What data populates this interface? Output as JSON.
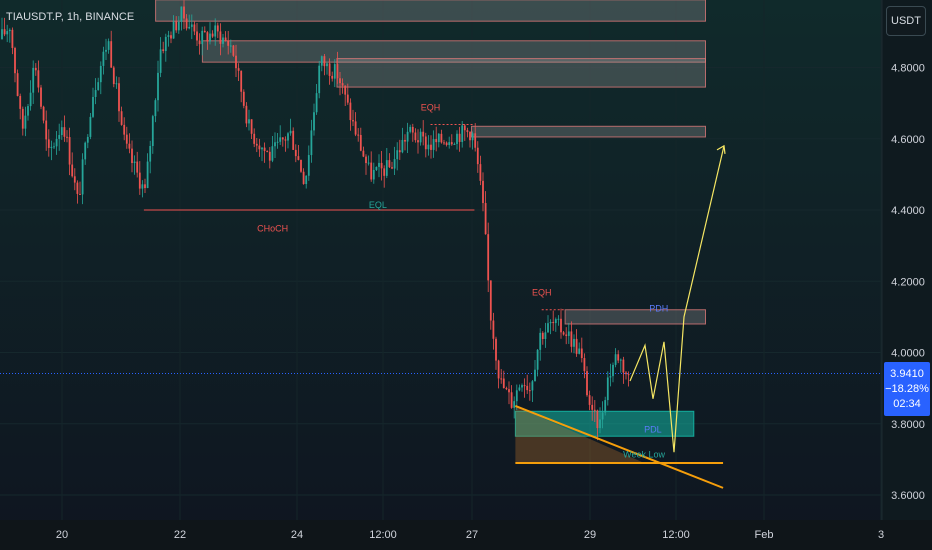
{
  "header": {
    "symbol": "TIAUSDT.P, 1h, BINANCE",
    "currency": "USDT"
  },
  "current": {
    "price": "3.9410",
    "change": "−18.28%",
    "countdown": "02:34"
  },
  "colors": {
    "bull": "#26a69a",
    "bear": "#ef5350",
    "projection": "#f5e663",
    "trendline": "#f59e0b",
    "demand": "#14b8a6",
    "supply": "#9e9e9e",
    "current_line": "#2962ff"
  },
  "chart_data": {
    "type": "candlestick",
    "title": "TIAUSDT.P, 1h, BINANCE",
    "ylim": [
      3.55,
      5.0
    ],
    "y_ticks": [
      "4.8000",
      "4.6000",
      "4.4000",
      "4.2000",
      "4.0000",
      "3.8000",
      "3.6000"
    ],
    "x_ticks": [
      "20",
      "22",
      "24",
      "12:00",
      "27",
      "29",
      "12:00",
      "Feb",
      "3"
    ],
    "current_price": 3.941,
    "zones": [
      {
        "kind": "supply",
        "y": [
          4.93,
          4.99
        ],
        "x": [
          "21.6",
          "31.0"
        ]
      },
      {
        "kind": "supply",
        "y": [
          4.815,
          4.875
        ],
        "x": [
          "22.4",
          "31.0"
        ]
      },
      {
        "kind": "supply",
        "y": [
          4.745,
          4.825
        ],
        "x": [
          "24.7",
          "31.0"
        ]
      },
      {
        "kind": "supply",
        "y": [
          4.605,
          4.635
        ],
        "x": [
          "27.0",
          "31.0"
        ]
      },
      {
        "kind": "supply",
        "y": [
          4.08,
          4.12
        ],
        "x": [
          "28.6",
          "31.0"
        ]
      },
      {
        "kind": "demand",
        "y": [
          3.765,
          3.835
        ],
        "x": [
          "27.75",
          "30.8"
        ]
      }
    ],
    "annotations": [
      {
        "text": "CHoCH",
        "x": "23.6",
        "y": 4.34,
        "color": "#ef5350"
      },
      {
        "text": "EQL",
        "x": "25.4",
        "y": 4.405,
        "color": "#26a69a"
      },
      {
        "text": "EQH",
        "x": "26.3",
        "y": 4.68,
        "color": "#ef5350"
      },
      {
        "text": "EQH",
        "x": "28.2",
        "y": 4.16,
        "color": "#ef5350"
      },
      {
        "text": "PDH",
        "x": "30.2",
        "y": 4.115,
        "color": "#5b7cfa"
      },
      {
        "text": "PDL",
        "x": "30.1",
        "y": 3.775,
        "color": "#5b7cfa"
      },
      {
        "text": "Week Low",
        "x": "29.95",
        "y": 3.705,
        "color": "#26a69a"
      }
    ]
  }
}
